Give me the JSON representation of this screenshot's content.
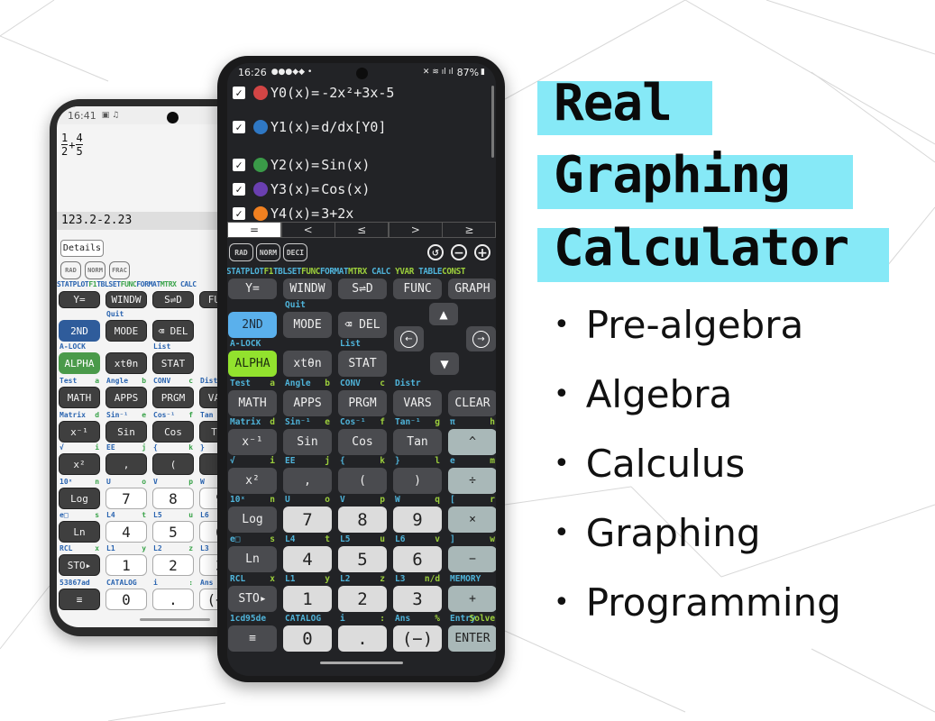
{
  "headline": {
    "lines": [
      "Real",
      "Graphing",
      "Calculator"
    ],
    "highlight_color": "#86e9f7"
  },
  "features": [
    "Pre-algebra",
    "Algebra",
    "Calculus",
    "Graphing",
    "Programming"
  ],
  "phone_main": {
    "status": {
      "time": "16:26",
      "battery": "87%"
    },
    "equations": [
      {
        "name": "Y0(x)=",
        "expr": "-2x²+3x-5",
        "color": "#d24545",
        "checked": true
      },
      {
        "name": "Y1(x)=",
        "expr": "d/dx[Y0]",
        "color": "#2f78c4",
        "checked": true
      },
      {
        "name": "Y2(x)=",
        "expr": "Sin(x)",
        "color": "#3a9a48",
        "checked": true
      },
      {
        "name": "Y3(x)=",
        "expr": "Cos(x)",
        "color": "#6a3fb0",
        "checked": true
      },
      {
        "name": "Y4(x)=",
        "expr": "3+2x",
        "color": "#f08020",
        "checked": true
      }
    ],
    "relations": [
      "=",
      "<",
      "≤",
      ">",
      "≥"
    ],
    "modes": [
      "RAD",
      "NORM",
      "DECI"
    ],
    "icons": [
      "history-icon",
      "zoom-out-icon",
      "zoom-in-icon"
    ],
    "second_strip": [
      {
        "t": "STATPLOT",
        "c": "b"
      },
      {
        "t": "F1",
        "c": "g"
      },
      {
        "t": "TBLSET",
        "c": "b"
      },
      {
        "t": "FUNC",
        "c": "g"
      },
      {
        "t": "FORMAT",
        "c": "b"
      },
      {
        "t": "MTRX",
        "c": "g"
      },
      {
        "t": " CALC ",
        "c": "b"
      },
      {
        "t": " YVAR ",
        "c": "g"
      },
      {
        "t": "TABLE",
        "c": "b"
      },
      {
        "t": "CONST",
        "c": "g"
      }
    ],
    "arrows": {
      "up": "▲",
      "down": "▼",
      "left": "←",
      "right": "→"
    },
    "keypad": {
      "rows": [
        {
          "labels": [],
          "keys": [
            {
              "label": "Y=",
              "s": "d"
            },
            {
              "label": "WINDW",
              "s": "d"
            },
            {
              "label": "S⇌D",
              "s": "d"
            },
            {
              "label": "FUNC",
              "s": "d"
            },
            {
              "label": "GRAPH",
              "s": "d"
            }
          ]
        },
        {
          "labels": [
            [
              "",
              ""
            ],
            [
              "Quit",
              ""
            ],
            [
              "",
              ""
            ]
          ],
          "keys": [
            {
              "label": "2ND",
              "s": "blue"
            },
            {
              "label": "MODE",
              "s": "d"
            },
            {
              "label": "⌫ DEL",
              "s": "d"
            }
          ]
        },
        {
          "labels": [
            [
              "A-LOCK",
              ""
            ],
            [
              "",
              ""
            ],
            [
              "List",
              ""
            ]
          ],
          "keys": [
            {
              "label": "ALPHA",
              "s": "green"
            },
            {
              "label": "xtθn",
              "s": "d"
            },
            {
              "label": "STAT",
              "s": "d"
            }
          ]
        },
        {
          "labels": [
            [
              "Test",
              "a"
            ],
            [
              "Angle",
              "b"
            ],
            [
              "CONV",
              "c"
            ],
            [
              "Distr",
              ""
            ],
            [
              "",
              ""
            ]
          ],
          "keys": [
            {
              "label": "MATH",
              "s": "d"
            },
            {
              "label": "APPS",
              "s": "d"
            },
            {
              "label": "PRGM",
              "s": "d"
            },
            {
              "label": "VARS",
              "s": "d"
            },
            {
              "label": "CLEAR",
              "s": "d"
            }
          ]
        },
        {
          "labels": [
            [
              "Matrix",
              "d"
            ],
            [
              "Sin⁻¹",
              "e"
            ],
            [
              "Cos⁻¹",
              "f"
            ],
            [
              "Tan⁻¹",
              "g"
            ],
            [
              "π",
              "h"
            ]
          ],
          "keys": [
            {
              "label": "x⁻¹",
              "s": "d"
            },
            {
              "label": "Sin",
              "s": "d"
            },
            {
              "label": "Cos",
              "s": "d"
            },
            {
              "label": "Tan",
              "s": "d"
            },
            {
              "label": "^",
              "s": "op"
            }
          ]
        },
        {
          "labels": [
            [
              "√",
              "i"
            ],
            [
              "EE",
              "j"
            ],
            [
              "{",
              "k"
            ],
            [
              "}",
              "l"
            ],
            [
              "e",
              "m"
            ]
          ],
          "keys": [
            {
              "label": "x²",
              "s": "d"
            },
            {
              "label": ",",
              "s": "d"
            },
            {
              "label": "(",
              "s": "d"
            },
            {
              "label": ")",
              "s": "d"
            },
            {
              "label": "÷",
              "s": "op"
            }
          ]
        },
        {
          "labels": [
            [
              "10ˣ",
              "n"
            ],
            [
              "U",
              "o"
            ],
            [
              "V",
              "p"
            ],
            [
              "W",
              "q"
            ],
            [
              "[",
              "r"
            ]
          ],
          "keys": [
            {
              "label": "Log",
              "s": "d"
            },
            {
              "label": "7",
              "s": "n"
            },
            {
              "label": "8",
              "s": "n"
            },
            {
              "label": "9",
              "s": "n"
            },
            {
              "label": "×",
              "s": "op"
            }
          ]
        },
        {
          "labels": [
            [
              "e□",
              "s"
            ],
            [
              "L4",
              "t"
            ],
            [
              "L5",
              "u"
            ],
            [
              "L6",
              "v"
            ],
            [
              "]",
              "w"
            ]
          ],
          "keys": [
            {
              "label": "Ln",
              "s": "d"
            },
            {
              "label": "4",
              "s": "n"
            },
            {
              "label": "5",
              "s": "n"
            },
            {
              "label": "6",
              "s": "n"
            },
            {
              "label": "−",
              "s": "op"
            }
          ]
        },
        {
          "labels": [
            [
              "RCL",
              "x"
            ],
            [
              "L1",
              "y"
            ],
            [
              "L2",
              "z"
            ],
            [
              "L3",
              "n/d"
            ],
            [
              "MEMORY",
              ""
            ]
          ],
          "keys": [
            {
              "label": "STO▸",
              "s": "d"
            },
            {
              "label": "1",
              "s": "n"
            },
            {
              "label": "2",
              "s": "n"
            },
            {
              "label": "3",
              "s": "n"
            },
            {
              "label": "+",
              "s": "op"
            }
          ]
        },
        {
          "labels": [
            [
              "1cd95de",
              ""
            ],
            [
              "CATALOG",
              ""
            ],
            [
              "i",
              ":"
            ],
            [
              "Ans",
              "%"
            ],
            [
              "Entry",
              "Solve"
            ]
          ],
          "keys": [
            {
              "label": "≡",
              "s": "d"
            },
            {
              "label": "0",
              "s": "n"
            },
            {
              "label": ".",
              "s": "n"
            },
            {
              "label": "(−)",
              "s": "n"
            },
            {
              "label": "ENTER",
              "s": "op"
            }
          ]
        }
      ]
    }
  },
  "phone_back": {
    "status": {
      "time": "16:41"
    },
    "expression": {
      "num1": "1",
      "den1": "2",
      "op": "+",
      "num2": "4",
      "den2": "5"
    },
    "history": "123.2-2.23",
    "details_button": "Details",
    "modes": [
      "RAD",
      "NORM",
      "FRAC"
    ],
    "second_strip": [
      {
        "t": "STATPLOT",
        "c": "b"
      },
      {
        "t": "F1",
        "c": "g"
      },
      {
        "t": "TBLSET",
        "c": "b"
      },
      {
        "t": "FUNC",
        "c": "g"
      },
      {
        "t": "FORMAT",
        "c": "b"
      },
      {
        "t": "MTRX",
        "c": "g"
      },
      {
        "t": " CALC",
        "c": "b"
      }
    ],
    "keypad": {
      "rows": [
        {
          "labels": [],
          "keys": [
            {
              "label": "Y=",
              "s": "d"
            },
            {
              "label": "WINDW",
              "s": "d"
            },
            {
              "label": "S⇌D",
              "s": "d"
            },
            {
              "label": "FUNC",
              "s": "d"
            }
          ]
        },
        {
          "labels": [
            [
              "",
              ""
            ],
            [
              "Quit",
              ""
            ],
            [
              "",
              ""
            ]
          ],
          "keys": [
            {
              "label": "2ND",
              "s": "blue"
            },
            {
              "label": "MODE",
              "s": "d"
            },
            {
              "label": "⌫ DEL",
              "s": "d"
            }
          ]
        },
        {
          "labels": [
            [
              "A-LOCK",
              ""
            ],
            [
              "",
              ""
            ],
            [
              "List",
              ""
            ]
          ],
          "keys": [
            {
              "label": "ALPHA",
              "s": "green"
            },
            {
              "label": "xtθn",
              "s": "d"
            },
            {
              "label": "STAT",
              "s": "d"
            }
          ]
        },
        {
          "labels": [
            [
              "Test",
              "a"
            ],
            [
              "Angle",
              "b"
            ],
            [
              "CONV",
              "c"
            ],
            [
              "Distr",
              ""
            ]
          ],
          "keys": [
            {
              "label": "MATH",
              "s": "d"
            },
            {
              "label": "APPS",
              "s": "d"
            },
            {
              "label": "PRGM",
              "s": "d"
            },
            {
              "label": "VARS",
              "s": "d"
            }
          ]
        },
        {
          "labels": [
            [
              "Matrix",
              "d"
            ],
            [
              "Sin⁻¹",
              "e"
            ],
            [
              "Cos⁻¹",
              "f"
            ],
            [
              "Tan",
              ""
            ]
          ],
          "keys": [
            {
              "label": "x⁻¹",
              "s": "d"
            },
            {
              "label": "Sin",
              "s": "d"
            },
            {
              "label": "Cos",
              "s": "d"
            },
            {
              "label": "Tan",
              "s": "d"
            }
          ]
        },
        {
          "labels": [
            [
              "√",
              "i"
            ],
            [
              "EE",
              "j"
            ],
            [
              "{",
              "k"
            ],
            [
              "}",
              ""
            ]
          ],
          "keys": [
            {
              "label": "x²",
              "s": "d"
            },
            {
              "label": ",",
              "s": "d"
            },
            {
              "label": "(",
              "s": "d"
            },
            {
              "label": ")",
              "s": "d"
            }
          ]
        },
        {
          "labels": [
            [
              "10ˣ",
              "n"
            ],
            [
              "U",
              "o"
            ],
            [
              "V",
              "p"
            ],
            [
              "W",
              ""
            ]
          ],
          "keys": [
            {
              "label": "Log",
              "s": "d"
            },
            {
              "label": "7",
              "s": "n"
            },
            {
              "label": "8",
              "s": "n"
            },
            {
              "label": "9",
              "s": "n"
            }
          ]
        },
        {
          "labels": [
            [
              "e□",
              "s"
            ],
            [
              "L4",
              "t"
            ],
            [
              "L5",
              "u"
            ],
            [
              "L6",
              ""
            ]
          ],
          "keys": [
            {
              "label": "Ln",
              "s": "d"
            },
            {
              "label": "4",
              "s": "n"
            },
            {
              "label": "5",
              "s": "n"
            },
            {
              "label": "6",
              "s": "n"
            }
          ]
        },
        {
          "labels": [
            [
              "RCL",
              "x"
            ],
            [
              "L1",
              "y"
            ],
            [
              "L2",
              "z"
            ],
            [
              "L3",
              ""
            ]
          ],
          "keys": [
            {
              "label": "STO▸",
              "s": "d"
            },
            {
              "label": "1",
              "s": "n"
            },
            {
              "label": "2",
              "s": "n"
            },
            {
              "label": "3",
              "s": "n"
            }
          ]
        },
        {
          "labels": [
            [
              "53867ad",
              ""
            ],
            [
              "CATALOG",
              ""
            ],
            [
              "i",
              ":"
            ],
            [
              "Ans",
              ""
            ]
          ],
          "keys": [
            {
              "label": "≡",
              "s": "d"
            },
            {
              "label": "0",
              "s": "n"
            },
            {
              "label": ".",
              "s": "n"
            },
            {
              "label": "(−)",
              "s": "n"
            }
          ]
        }
      ]
    }
  }
}
